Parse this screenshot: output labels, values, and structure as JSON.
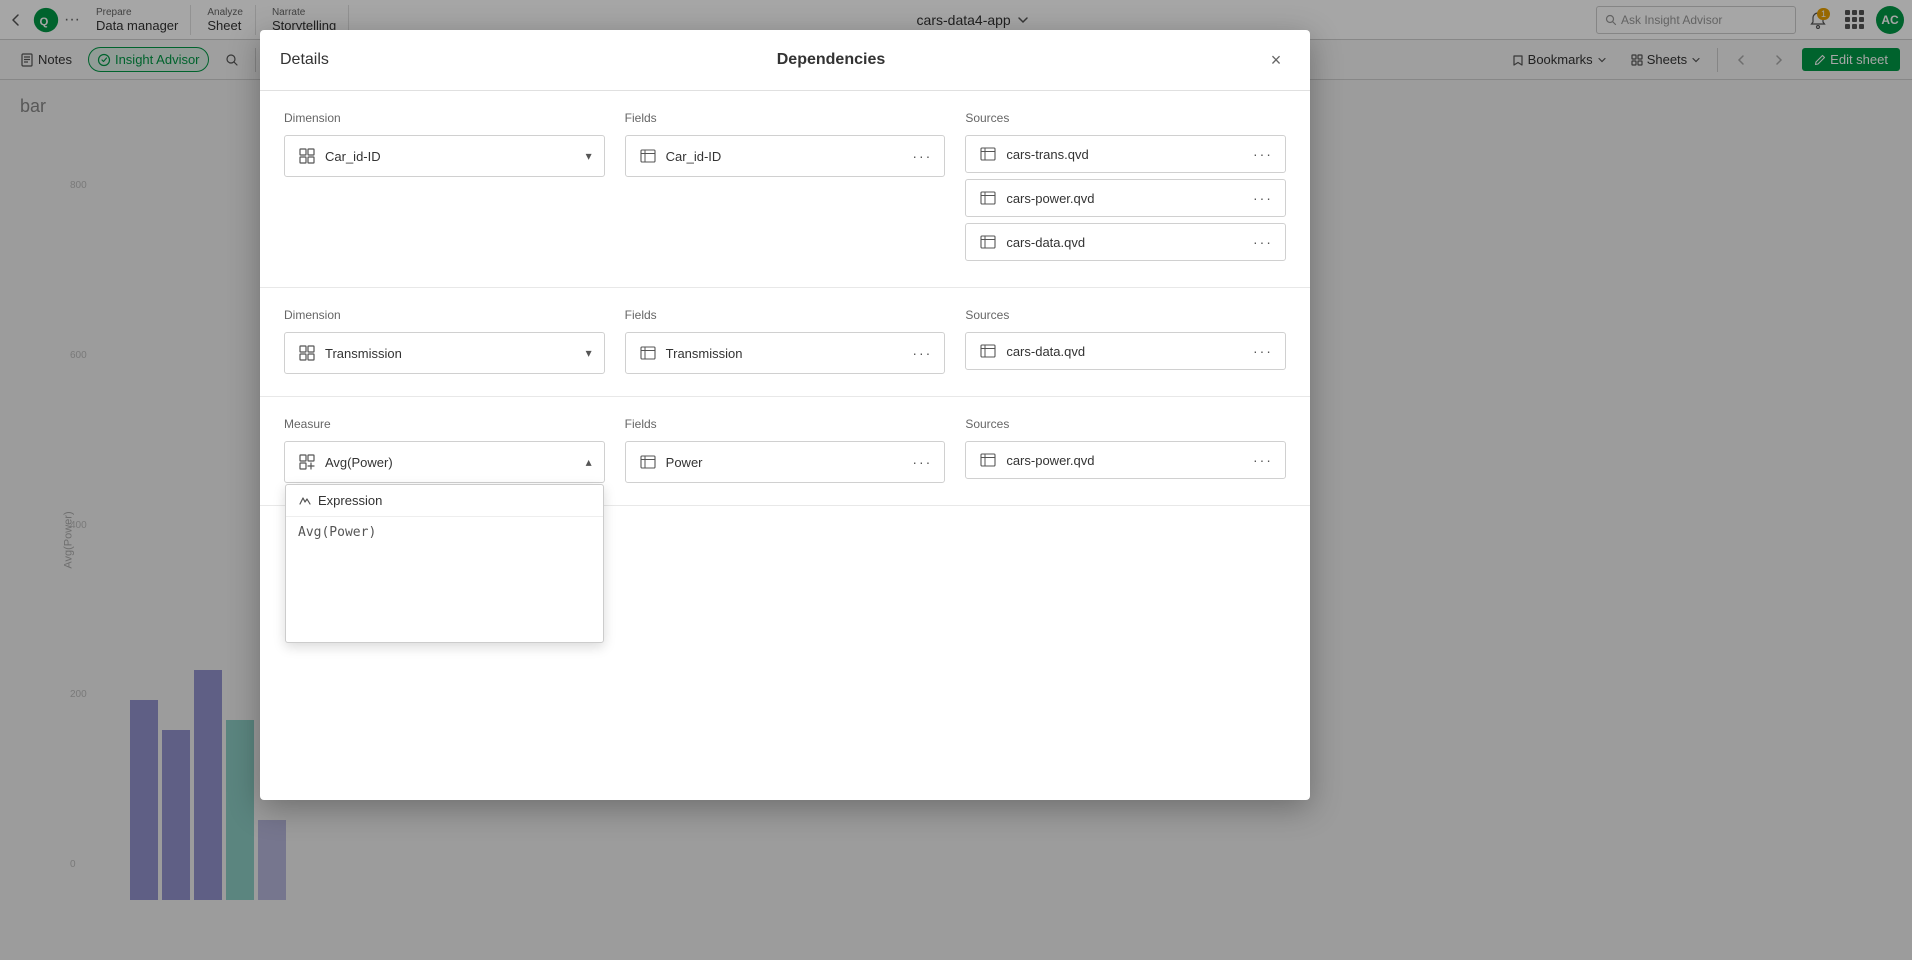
{
  "topbar": {
    "back_icon": "chevron-left",
    "qlik_logo": "Q",
    "more_icon": "ellipsis",
    "prepare_label": "Prepare",
    "prepare_sub": "Data manager",
    "analyze_label": "Analyze",
    "analyze_sub": "Sheet",
    "narrate_label": "Narrate",
    "narrate_sub": "Storytelling",
    "app_title": "cars-data4-app",
    "search_placeholder": "Ask Insight Advisor",
    "notif_count": "1",
    "avatar_initials": "AC"
  },
  "secbar": {
    "notes_label": "Notes",
    "insight_label": "Insight Advisor",
    "undo_icon": "undo",
    "redo_icon": "redo",
    "bookmarks_label": "Bookmarks",
    "sheets_label": "Sheets",
    "edit_label": "Edit sheet"
  },
  "chart": {
    "title": "bar",
    "y_axis_label": "Avg(Power)"
  },
  "modal": {
    "title_left": "Details",
    "title_center": "Dependencies",
    "close_icon": "×",
    "sections": [
      {
        "dimension_label": "Dimension",
        "dimension_value": "Car_id-ID",
        "fields_label": "Fields",
        "field_value": "Car_id-ID",
        "sources_label": "Sources",
        "sources": [
          "cars-trans.qvd",
          "cars-power.qvd",
          "cars-data.qvd"
        ],
        "expanded": false
      },
      {
        "dimension_label": "Dimension",
        "dimension_value": "Transmission",
        "fields_label": "Fields",
        "field_value": "Transmission",
        "sources_label": "Sources",
        "sources": [
          "cars-data.qvd"
        ],
        "expanded": false
      },
      {
        "dimension_label": "Measure",
        "dimension_value": "Avg(Power)",
        "fields_label": "Fields",
        "field_value": "Power",
        "sources_label": "Sources",
        "sources": [
          "cars-power.qvd"
        ],
        "expanded": true,
        "expression_label": "Expression",
        "expression_value": "Avg(Power)"
      }
    ]
  }
}
